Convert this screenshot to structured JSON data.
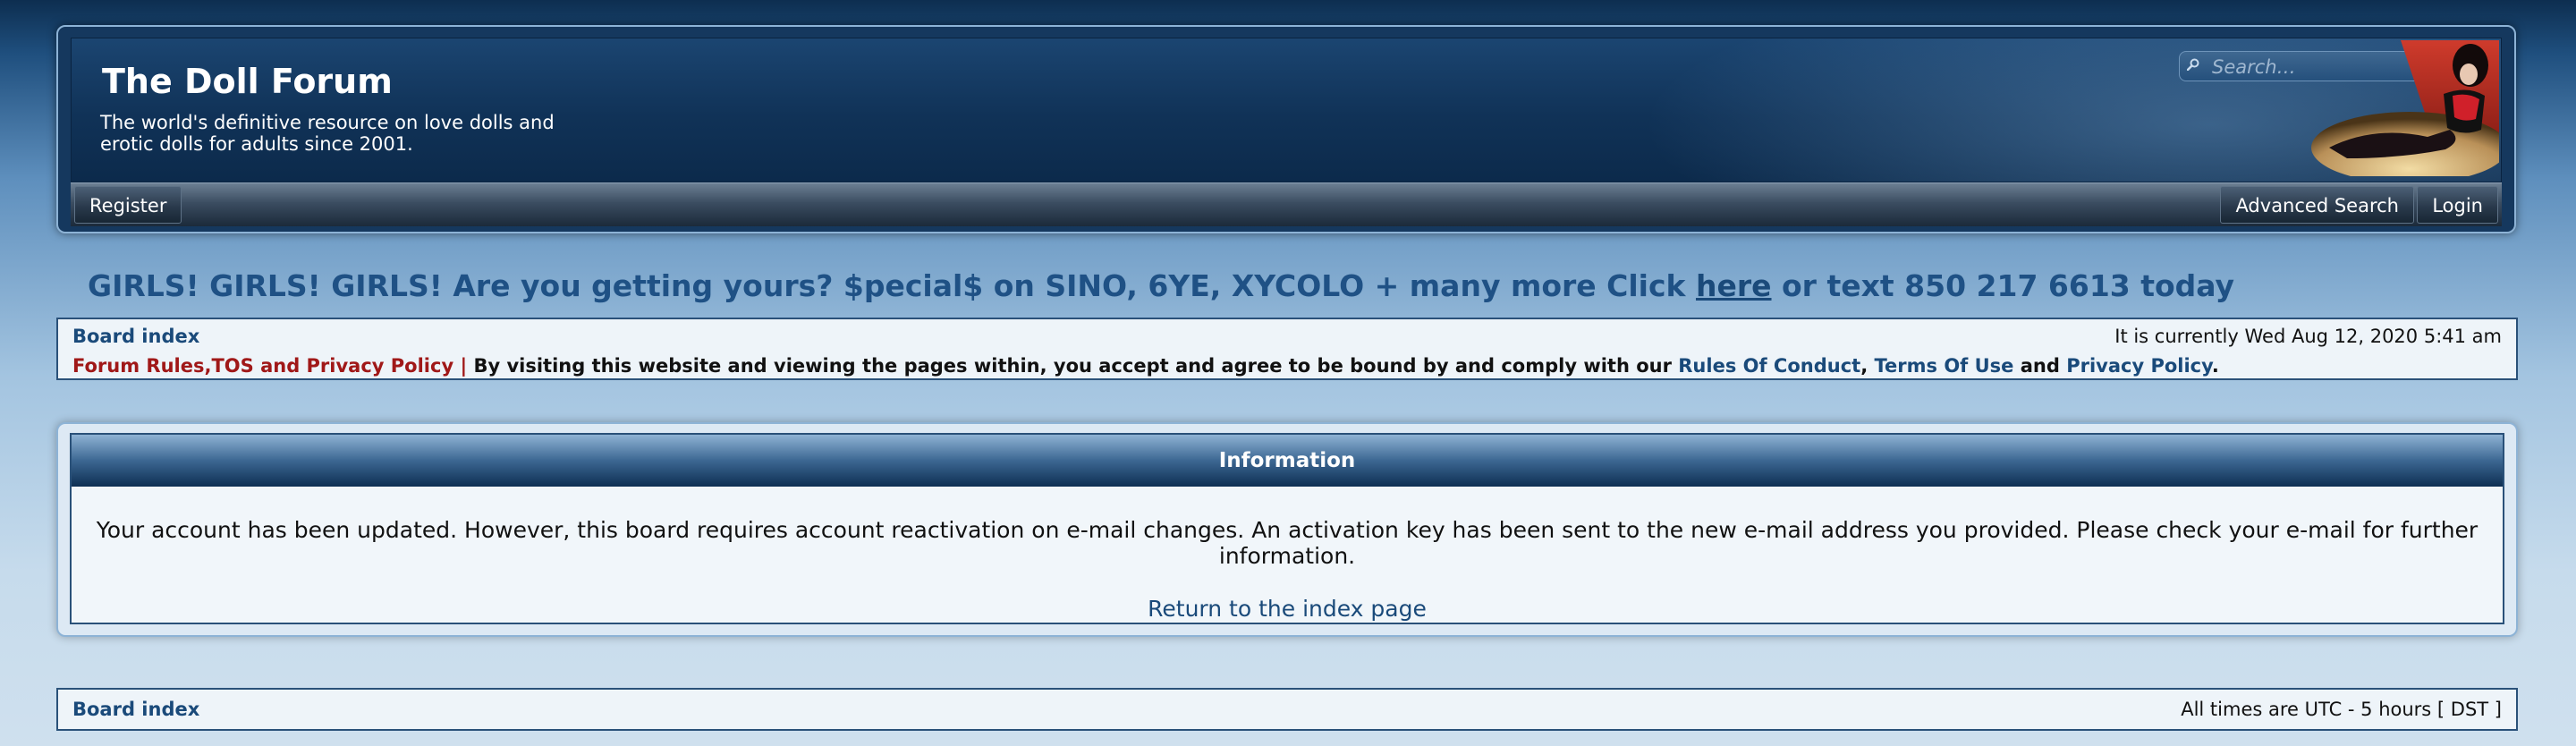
{
  "header": {
    "title": "The Doll Forum",
    "description": "The world's definitive resource on love dolls and erotic dolls for adults since 2001.",
    "search_placeholder": "Search…"
  },
  "nav": {
    "register": "Register",
    "advanced_search": "Advanced Search",
    "login": "Login"
  },
  "announcement": {
    "text_before": "GIRLS! GIRLS! GIRLS! Are you getting yours? $pecial$ on SINO, 6YE, XYCOLO + many more Click ",
    "link": "here",
    "text_after": " or text 850 217 6613 today"
  },
  "breadcrumb_top": {
    "board_index": "Board index",
    "current_time": "It is currently Wed Aug 12, 2020 5:41 am",
    "rules_link": "Forum Rules,TOS and Privacy Policy",
    "rules_sep": " | ",
    "rules_text": "By visiting this website and viewing the pages within, you accept and agree to be bound by and comply with our ",
    "rules_of_conduct": "Rules Of Conduct",
    "comma": ", ",
    "terms_of_use": "Terms Of Use",
    "and": " and ",
    "privacy_policy": "Privacy Policy",
    "period": "."
  },
  "information": {
    "title": "Information",
    "message": "Your account has been updated. However, this board requires account reactivation on e-mail changes. An activation key has been sent to the new e-mail address you provided. Please check your e-mail for further information.",
    "return_link": "Return to the index page"
  },
  "breadcrumb_bottom": {
    "board_index": "Board index",
    "timezone": "All times are UTC - 5 hours [ DST ]"
  },
  "colors": {
    "link": "#1a4a7a",
    "rules_red": "#a01818",
    "announce": "#1f5185"
  }
}
